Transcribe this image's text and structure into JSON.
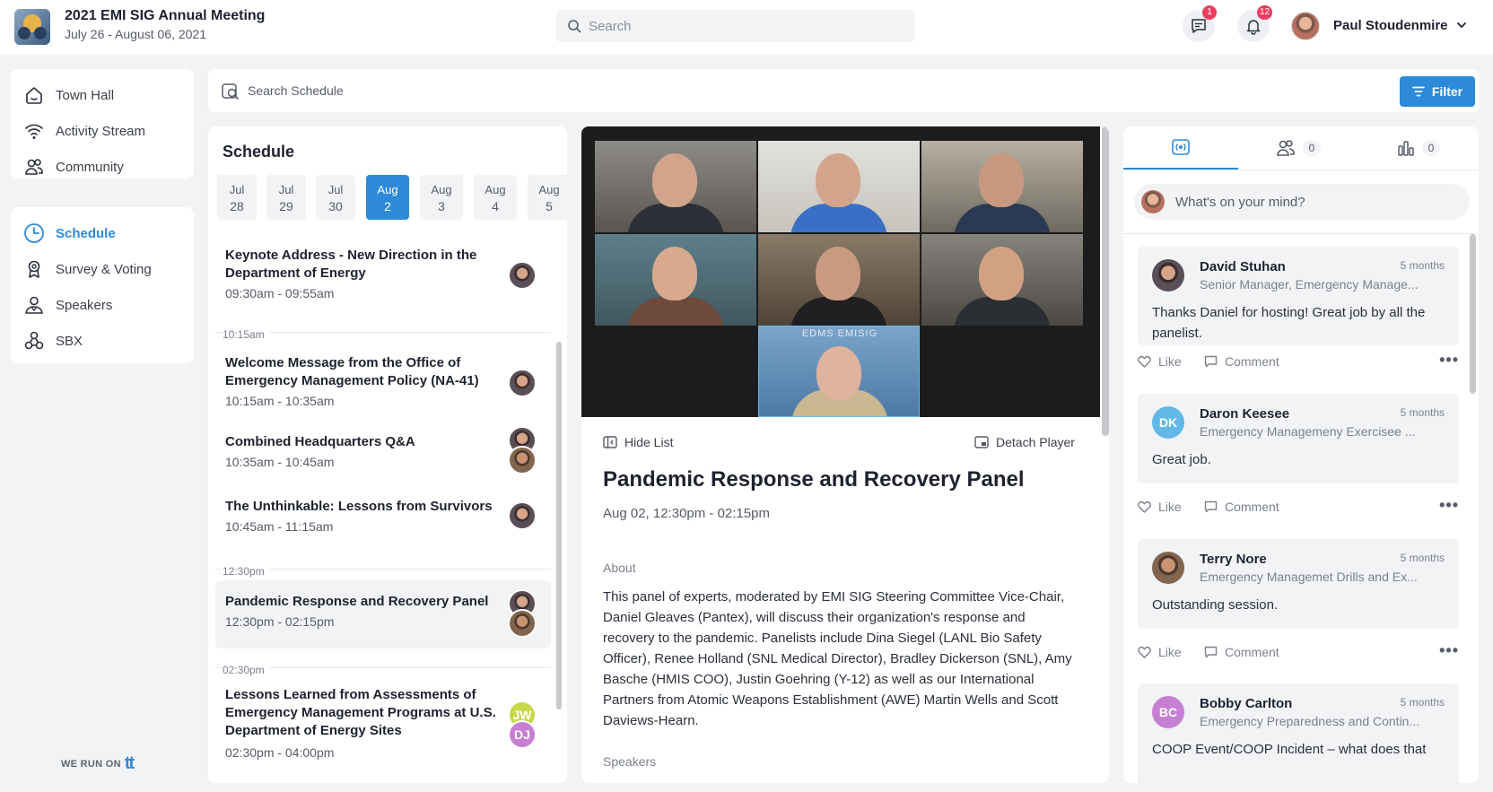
{
  "header": {
    "app_title": "2021 EMI SIG Annual Meeting",
    "app_dates": "July 26 - August 06, 2021",
    "search_placeholder": "Search",
    "chat_badge": "1",
    "notifications_badge": "12",
    "user_name": "Paul Stoudenmire"
  },
  "sidebar": {
    "group1": [
      {
        "label": "Town Hall",
        "icon": "home-icon"
      },
      {
        "label": "Activity Stream",
        "icon": "wifi-icon"
      },
      {
        "label": "Community",
        "icon": "people-icon"
      }
    ],
    "group2": [
      {
        "label": "Schedule",
        "icon": "clock-icon",
        "active": true
      },
      {
        "label": "Survey & Voting",
        "icon": "badge-icon"
      },
      {
        "label": "Speakers",
        "icon": "speaker-icon"
      },
      {
        "label": "SBX",
        "icon": "network-icon"
      }
    ],
    "we_run_on": "WE RUN ON",
    "brand_mark": "tt"
  },
  "toolbar": {
    "search_placeholder": "Search Schedule",
    "filter_label": "Filter"
  },
  "schedule": {
    "title": "Schedule",
    "dates": [
      {
        "month": "Jul",
        "day": "28"
      },
      {
        "month": "Jul",
        "day": "29"
      },
      {
        "month": "Jul",
        "day": "30"
      },
      {
        "month": "Aug",
        "day": "2",
        "active": true
      },
      {
        "month": "Aug",
        "day": "3"
      },
      {
        "month": "Aug",
        "day": "4"
      },
      {
        "month": "Aug",
        "day": "5"
      }
    ],
    "sections": [
      "10:15am",
      "12:30pm",
      "02:30pm"
    ],
    "sessions": [
      {
        "title": "Keynote Address - New Direction in the Department of Energy",
        "time": "09:30am - 09:55am"
      },
      {
        "title": "Welcome Message from the Office of Emergency Management Policy (NA-41)",
        "time": "10:15am - 10:35am"
      },
      {
        "title": "Combined Headquarters Q&A",
        "time": "10:35am - 10:45am"
      },
      {
        "title": "The Unthinkable: Lessons from Survivors",
        "time": "10:45am - 11:15am"
      },
      {
        "title": "Pandemic Response and Recovery Panel",
        "time": "12:30pm - 02:15pm",
        "active": true
      },
      {
        "title": "Lessons Learned from Assessments of Emergency Management Programs at U.S. Department of Energy Sites",
        "time": "02:30pm - 04:00pm",
        "speakers": [
          "JW",
          "DJ"
        ]
      }
    ]
  },
  "detail": {
    "hide_list": "Hide List",
    "detach_player": "Detach Player",
    "title": "Pandemic Response and Recovery Panel",
    "time": "Aug 02, 12:30pm - 02:15pm",
    "about_label": "About",
    "about_text": "This panel of experts, moderated by EMI SIG Steering Committee Vice-Chair, Daniel Gleaves (Pantex), will discuss their organization's response and recovery to the pandemic. Panelists include Dina Siegel (LANL Bio Safety Officer), Renee Holland (SNL Medical Director), Bradley Dickerson (SNL), Amy Basche (HMIS COO), Justin Goehring (Y-12) as well as our International Partners from Atomic Weapons Establishment (AWE) Martin Wells and Scott Daviews-Hearn.",
    "speakers_label": "Speakers",
    "video_banner": "EDMS EMISIG"
  },
  "social": {
    "tabs": [
      {
        "icon": "live-icon"
      },
      {
        "icon": "people-icon",
        "count": "0"
      },
      {
        "icon": "bar-chart-icon",
        "count": "0"
      }
    ],
    "composer_placeholder": "What's on your mind?",
    "like_label": "Like",
    "comment_label": "Comment",
    "posts": [
      {
        "name": "David Stuhan",
        "time": "5 months",
        "role": "Senior Manager, Emergency Manage...",
        "text": "Thanks Daniel for hosting! Great job by all the panelist."
      },
      {
        "name": "Daron Keesee",
        "time": "5 months",
        "role": "Emergency Managemeny Exercisee ...",
        "text": "Great job.",
        "initials": "DK"
      },
      {
        "name": "Terry Nore",
        "time": "5 months",
        "role": "Emergency Managemet Drills and Ex...",
        "text": "Outstanding session."
      },
      {
        "name": "Bobby Carlton",
        "time": "5 months",
        "role": "Emergency Preparedness and Contin...",
        "text": "COOP Event/COOP Incident – what does that",
        "initials": "BC"
      }
    ]
  },
  "colors": {
    "accent": "#2d8ad9",
    "badge": "#ec3d61",
    "dk": "#62b9e8",
    "bc": "#c77fd4",
    "jw": "#c6d84a",
    "dj": "#c77fd4"
  }
}
